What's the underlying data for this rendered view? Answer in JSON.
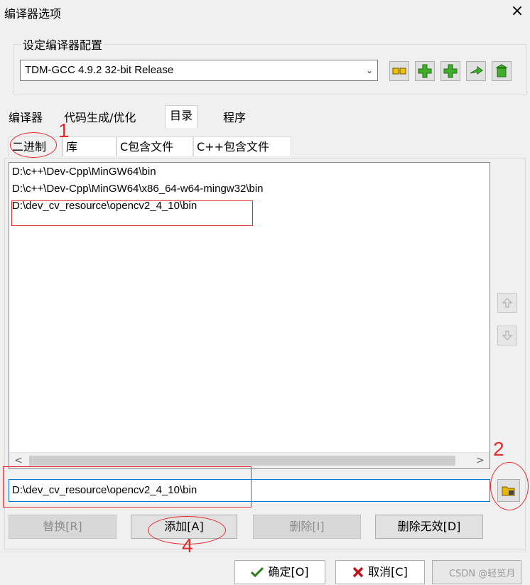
{
  "window": {
    "title": "编译器选项",
    "close_symbol": "×"
  },
  "compiler_group": {
    "label": "设定编译器配置",
    "selected_profile": "TDM-GCC 4.9.2 32-bit Release"
  },
  "main_tabs": [
    {
      "label": "编译器"
    },
    {
      "label": "代码生成/优化"
    },
    {
      "label": "目录",
      "selected": true
    },
    {
      "label": "程序"
    }
  ],
  "sub_tabs": [
    {
      "label": "二进制",
      "selected": true
    },
    {
      "label": "库"
    },
    {
      "label": "C包含文件"
    },
    {
      "label": "C++包含文件"
    }
  ],
  "directory_list": [
    "D:\\c++\\Dev-Cpp\\MinGW64\\bin",
    "D:\\c++\\Dev-Cpp\\MinGW64\\x86_64-w64-mingw32\\bin",
    "D:\\dev_cv_resource\\opencv2_4_10\\bin"
  ],
  "path_input": {
    "value": "D:\\dev_cv_resource\\opencv2_4_10\\bin"
  },
  "action_buttons": {
    "replace": "替换[R]",
    "add": "添加[A]",
    "delete": "删除[I]",
    "delete_invalid": "删除无效[D]"
  },
  "dialog_buttons": {
    "ok": "确定[O]",
    "cancel": "取消[C]"
  },
  "annotations": {
    "n1": "1",
    "n2": "2",
    "n4": "4"
  },
  "watermark": "CSDN @轻览月",
  "colors": {
    "annotation_red": "#e52b2b",
    "focus_blue": "#0078d7"
  }
}
